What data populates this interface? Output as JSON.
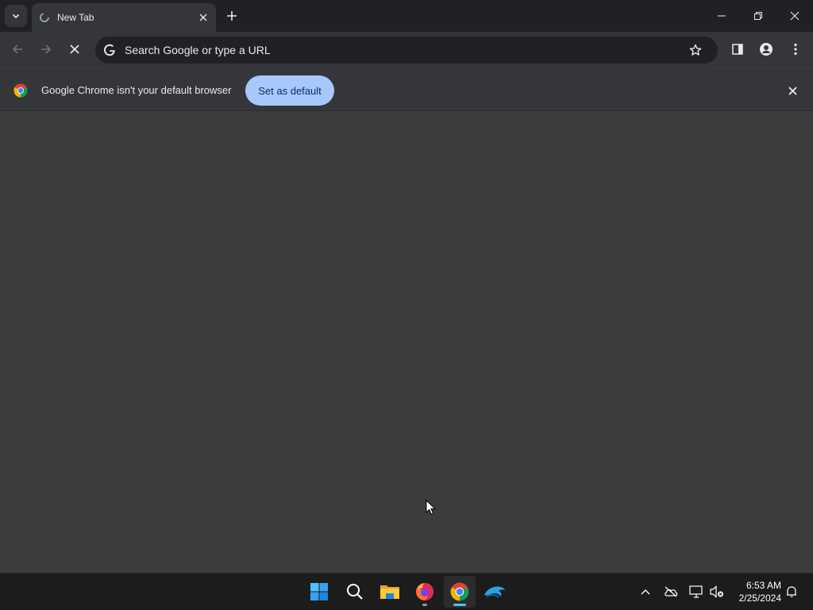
{
  "tab": {
    "title": "New Tab"
  },
  "omnibox": {
    "placeholder": "Search Google or type a URL"
  },
  "infobar": {
    "message": "Google Chrome isn't your default browser",
    "button_label": "Set as default"
  },
  "taskbar": {
    "apps": [
      "start-icon",
      "search-icon",
      "file-explorer-icon",
      "firefox-icon",
      "chrome-icon",
      "dolphin-emulator-icon"
    ],
    "tray": [
      "chevron-up-icon",
      "onedrive-offline-icon",
      "network-icon",
      "volume-muted-icon",
      "notification-bell-icon"
    ]
  },
  "clock": {
    "time": "6:53 AM",
    "date": "2/25/2024"
  },
  "colors": {
    "accent_button": "#a8c7fa",
    "taskbar_indicator": "#4cc2ff"
  }
}
